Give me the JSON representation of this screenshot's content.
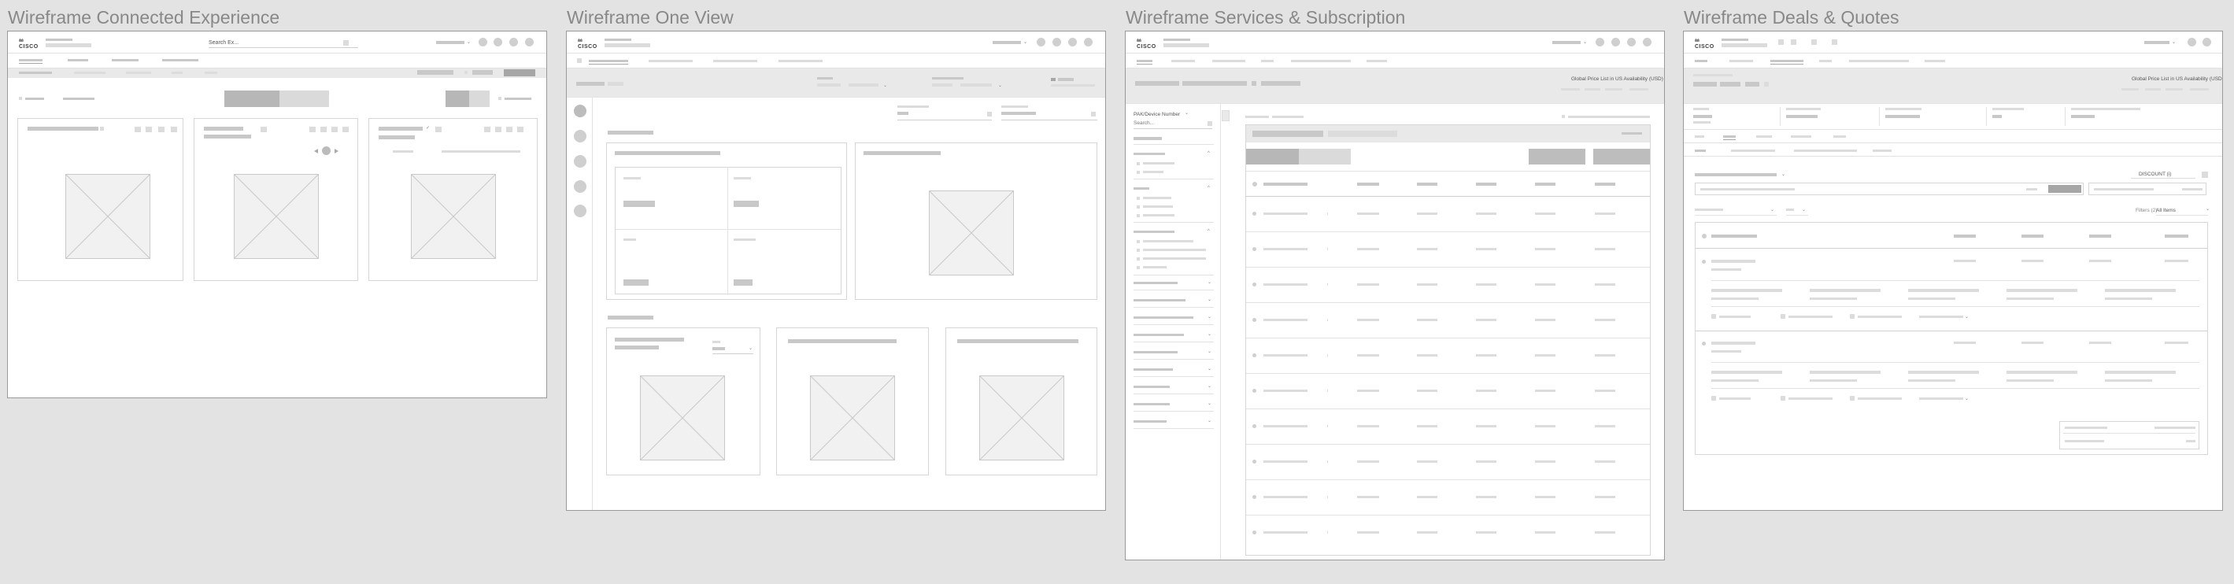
{
  "frames": [
    {
      "title": "Wireframe Connected Experience"
    },
    {
      "title": "Wireframe One View"
    },
    {
      "title": "Wireframe Services & Subscription"
    },
    {
      "title": "Wireframe Deals & Quotes"
    }
  ],
  "brand": {
    "logo_text": "CISCO"
  },
  "connected": {
    "search_label": "Search Ex..."
  },
  "services": {
    "header_right_text": "Global Price List in US Availability (USD)",
    "filter_title": "PAK/Device Number",
    "filter_search_placeholder": "Search..."
  },
  "deals": {
    "header_right_text": "Global Price List in US Availability (USD)",
    "discount_label": "DISCOUNT (i)",
    "filter_label": "Filters (2)",
    "filter_value": "All Items"
  },
  "icons": [
    "cisco-logo",
    "chevron-down-icon",
    "user-icon",
    "help-icon",
    "placeholder-image-icon",
    "play-icon",
    "previous-icon",
    "next-icon",
    "menu-icon"
  ]
}
